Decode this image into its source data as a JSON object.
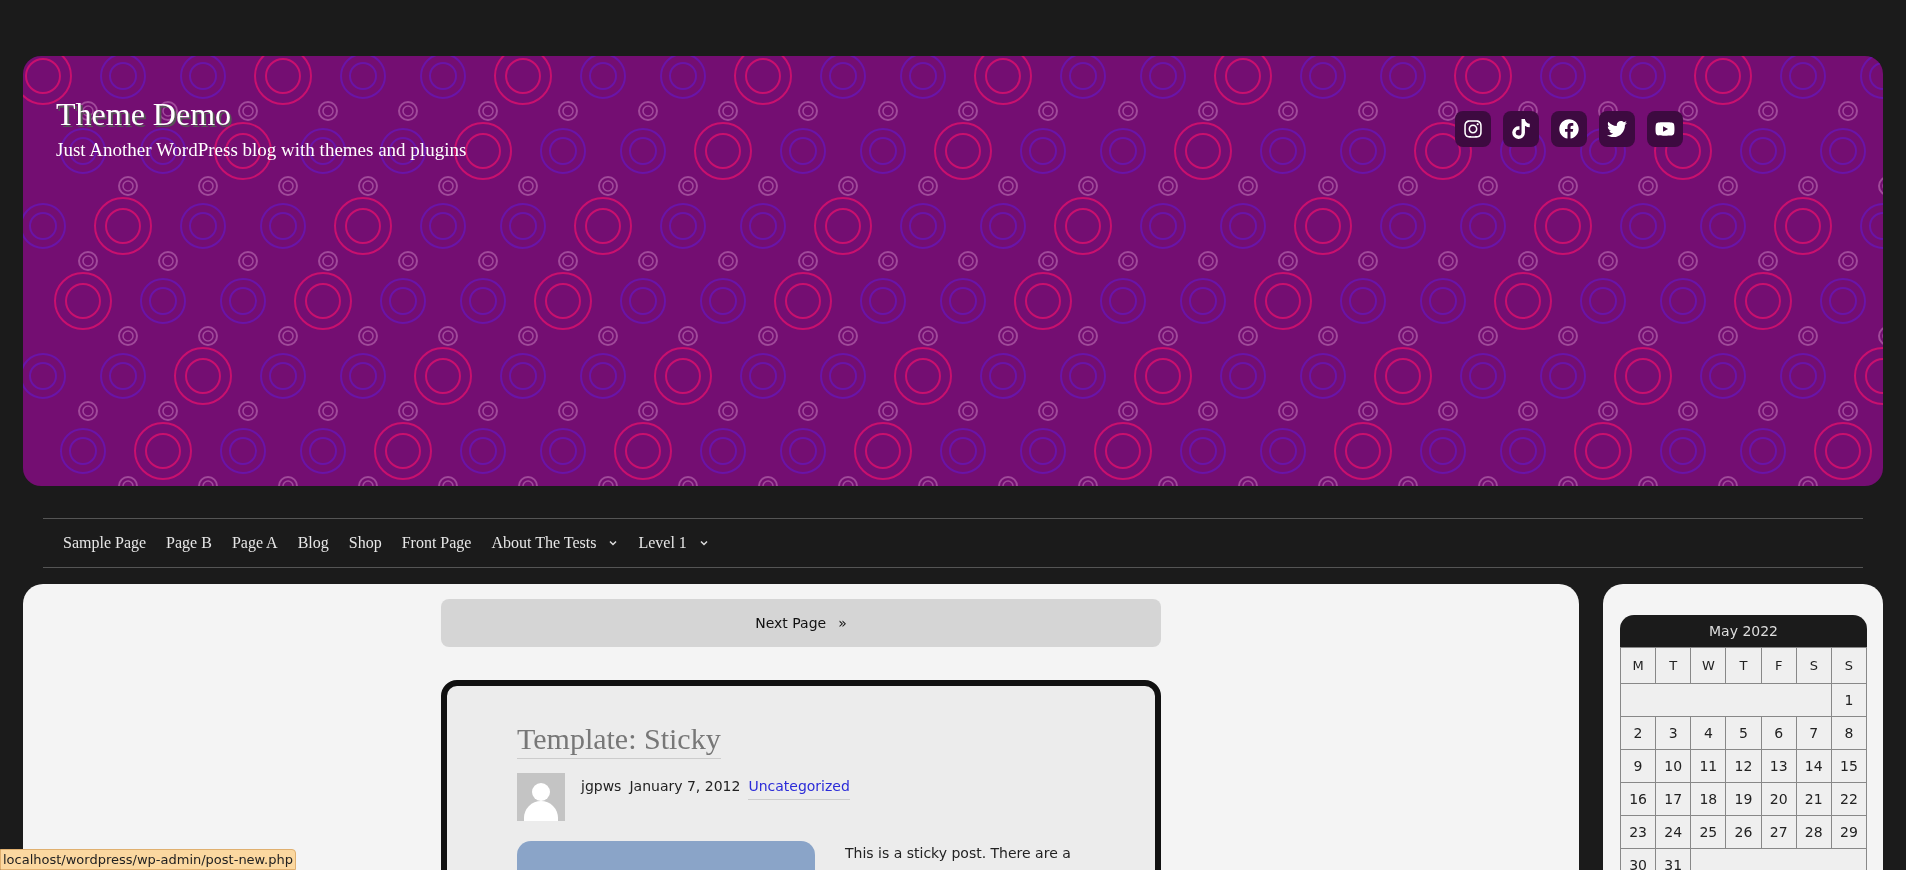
{
  "site": {
    "title": "Theme Demo",
    "tagline": "Just Another WordPress blog with themes and plugins"
  },
  "social_links": [
    {
      "kind": "instagram"
    },
    {
      "kind": "tiktok"
    },
    {
      "kind": "facebook"
    },
    {
      "kind": "twitter"
    },
    {
      "kind": "youtube"
    }
  ],
  "nav": [
    {
      "label": "Sample Page",
      "has_submenu": false
    },
    {
      "label": "Page B",
      "has_submenu": false
    },
    {
      "label": "Page A",
      "has_submenu": false
    },
    {
      "label": "Blog",
      "has_submenu": false
    },
    {
      "label": "Shop",
      "has_submenu": false
    },
    {
      "label": "Front Page",
      "has_submenu": false
    },
    {
      "label": "About The Tests",
      "has_submenu": true
    },
    {
      "label": "Level 1",
      "has_submenu": true
    }
  ],
  "pagination": {
    "label": "Next Page",
    "arrow": "»"
  },
  "post": {
    "title": "Template: Sticky",
    "author": "jgpws",
    "date": "January 7, 2012",
    "category": "Uncategorized",
    "excerpt": "This is a sticky post. There are a"
  },
  "calendar": {
    "caption": "May 2022",
    "weekdays": [
      "M",
      "T",
      "W",
      "T",
      "F",
      "S",
      "S"
    ],
    "weeks": [
      [
        "1"
      ],
      [
        "2",
        "3",
        "4",
        "5",
        "6",
        "7",
        "8"
      ],
      [
        "9",
        "10",
        "11",
        "12",
        "13",
        "14",
        "15"
      ],
      [
        "16",
        "17",
        "18",
        "19",
        "20",
        "21",
        "22"
      ],
      [
        "23",
        "24",
        "25",
        "26",
        "27",
        "28",
        "29"
      ],
      [
        "30",
        "31"
      ]
    ]
  },
  "status_bar": {
    "url": "localhost/wordpress/wp-admin/post-new.php"
  }
}
